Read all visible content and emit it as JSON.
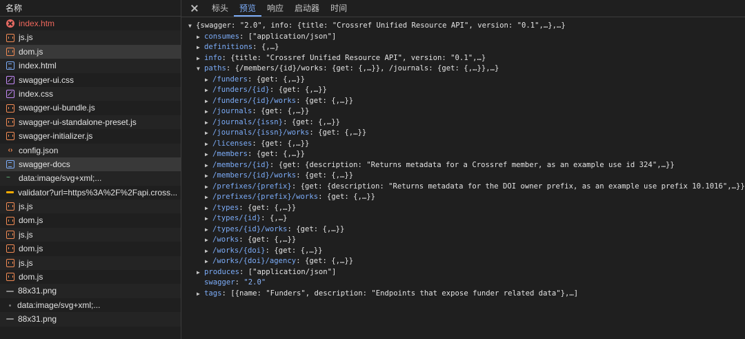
{
  "left": {
    "header": "名称",
    "requests": [
      {
        "icon": "err",
        "label": "index.htm",
        "error": true
      },
      {
        "icon": "js",
        "label": "js.js"
      },
      {
        "icon": "js",
        "label": "dom.js",
        "selected": true
      },
      {
        "icon": "doc",
        "label": "index.html"
      },
      {
        "icon": "css",
        "label": "swagger-ui.css"
      },
      {
        "icon": "css",
        "label": "index.css"
      },
      {
        "icon": "js",
        "label": "swagger-ui-bundle.js"
      },
      {
        "icon": "js",
        "label": "swagger-ui-standalone-preset.js"
      },
      {
        "icon": "js",
        "label": "swagger-initializer.js"
      },
      {
        "icon": "json",
        "label": "config.json"
      },
      {
        "icon": "doc",
        "label": "swagger-docs",
        "selected": true
      },
      {
        "icon": "svg",
        "label": "data:image/svg+xml;..."
      },
      {
        "icon": "xhr",
        "label": "validator?url=https%3A%2F%2Fapi.cross..."
      },
      {
        "icon": "js",
        "label": "js.js"
      },
      {
        "icon": "js",
        "label": "dom.js"
      },
      {
        "icon": "js",
        "label": "js.js"
      },
      {
        "icon": "js",
        "label": "dom.js"
      },
      {
        "icon": "js",
        "label": "js.js"
      },
      {
        "icon": "js",
        "label": "dom.js"
      },
      {
        "icon": "img",
        "label": "88x31.png"
      },
      {
        "icon": "dot",
        "label": "data:image/svg+xml;..."
      },
      {
        "icon": "img",
        "label": "88x31.png"
      }
    ]
  },
  "tabs": {
    "items": [
      "标头",
      "预览",
      "响应",
      "启动器",
      "时间"
    ],
    "active": 1
  },
  "tree": [
    {
      "indent": 0,
      "tri": "▼",
      "key": "",
      "sep": "",
      "val": "{swagger: \"2.0\", info: {title: \"Crossref Unified Resource API\", version: \"0.1\",…},…}"
    },
    {
      "indent": 1,
      "tri": "▶",
      "key": "consumes",
      "sep": ": ",
      "val": "[\"application/json\"]"
    },
    {
      "indent": 1,
      "tri": "▶",
      "key": "definitions",
      "sep": ": ",
      "val": "{,…}"
    },
    {
      "indent": 1,
      "tri": "▶",
      "key": "info",
      "sep": ": ",
      "val": "{title: \"Crossref Unified Resource API\", version: \"0.1\",…}"
    },
    {
      "indent": 1,
      "tri": "▼",
      "key": "paths",
      "sep": ": ",
      "val": "{/members/{id}/works: {get: {,…}}, /journals: {get: {,…}},…}"
    },
    {
      "indent": 2,
      "tri": "▶",
      "key": "/funders",
      "sep": ": ",
      "val": "{get: {,…}}"
    },
    {
      "indent": 2,
      "tri": "▶",
      "key": "/funders/{id}",
      "sep": ": ",
      "val": "{get: {,…}}"
    },
    {
      "indent": 2,
      "tri": "▶",
      "key": "/funders/{id}/works",
      "sep": ": ",
      "val": "{get: {,…}}"
    },
    {
      "indent": 2,
      "tri": "▶",
      "key": "/journals",
      "sep": ": ",
      "val": "{get: {,…}}"
    },
    {
      "indent": 2,
      "tri": "▶",
      "key": "/journals/{issn}",
      "sep": ": ",
      "val": "{get: {,…}}"
    },
    {
      "indent": 2,
      "tri": "▶",
      "key": "/journals/{issn}/works",
      "sep": ": ",
      "val": "{get: {,…}}"
    },
    {
      "indent": 2,
      "tri": "▶",
      "key": "/licenses",
      "sep": ": ",
      "val": "{get: {,…}}"
    },
    {
      "indent": 2,
      "tri": "▶",
      "key": "/members",
      "sep": ": ",
      "val": "{get: {,…}}"
    },
    {
      "indent": 2,
      "tri": "▶",
      "key": "/members/{id}",
      "sep": ": ",
      "val": "{get: {description: \"Returns metadata for a Crossref member, as an example use id 324\",…}}"
    },
    {
      "indent": 2,
      "tri": "▶",
      "key": "/members/{id}/works",
      "sep": ": ",
      "val": "{get: {,…}}"
    },
    {
      "indent": 2,
      "tri": "▶",
      "key": "/prefixes/{prefix}",
      "sep": ": ",
      "val": "{get: {description: \"Returns metadata for the DOI owner prefix, as an example use prefix 10.1016\",…}}"
    },
    {
      "indent": 2,
      "tri": "▶",
      "key": "/prefixes/{prefix}/works",
      "sep": ": ",
      "val": "{get: {,…}}"
    },
    {
      "indent": 2,
      "tri": "▶",
      "key": "/types",
      "sep": ": ",
      "val": "{get: {,…}}"
    },
    {
      "indent": 2,
      "tri": "▶",
      "key": "/types/{id}",
      "sep": ": ",
      "val": "{,…}"
    },
    {
      "indent": 2,
      "tri": "▶",
      "key": "/types/{id}/works",
      "sep": ": ",
      "val": "{get: {,…}}"
    },
    {
      "indent": 2,
      "tri": "▶",
      "key": "/works",
      "sep": ": ",
      "val": "{get: {,…}}"
    },
    {
      "indent": 2,
      "tri": "▶",
      "key": "/works/{doi}",
      "sep": ": ",
      "val": "{get: {,…}}"
    },
    {
      "indent": 2,
      "tri": "▶",
      "key": "/works/{doi}/agency",
      "sep": ": ",
      "val": "{get: {,…}}"
    },
    {
      "indent": 1,
      "tri": "▶",
      "key": "produces",
      "sep": ": ",
      "val": "[\"application/json\"]"
    },
    {
      "indent": 1,
      "tri": "",
      "key": "swagger",
      "sep": ": ",
      "val": "\"2.0\"",
      "string": true
    },
    {
      "indent": 1,
      "tri": "▶",
      "key": "tags",
      "sep": ": ",
      "val": "[{name: \"Funders\", description: \"Endpoints that expose funder related data\"},…]"
    }
  ]
}
